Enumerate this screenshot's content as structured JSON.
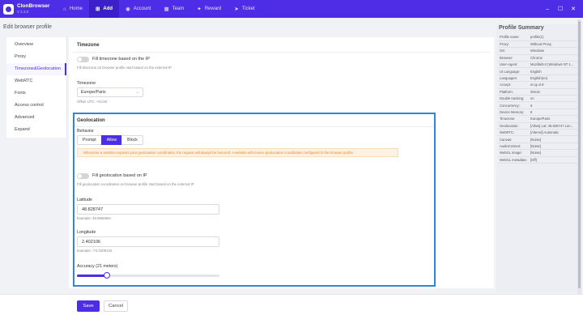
{
  "app": {
    "name": "ClonBrowser",
    "version": "V 2.3.0"
  },
  "nav": {
    "items": [
      {
        "label": "Home",
        "icon": "home-icon"
      },
      {
        "label": "Add",
        "icon": "add-icon"
      },
      {
        "label": "Account",
        "icon": "account-icon"
      },
      {
        "label": "Team",
        "icon": "team-icon"
      },
      {
        "label": "Reward",
        "icon": "reward-icon"
      },
      {
        "label": "Ticket",
        "icon": "ticket-icon"
      }
    ],
    "active": "Add",
    "accent_color": "#4d2ee6"
  },
  "window": {
    "minimize": "–",
    "restore": "☐",
    "close": "✕"
  },
  "page_title": "Edit browser profile",
  "sidebar": {
    "items": [
      {
        "label": "Overview"
      },
      {
        "label": "Proxy"
      },
      {
        "label": "Timezone&Geolocation"
      },
      {
        "label": "WebRTC"
      },
      {
        "label": "Fonts"
      },
      {
        "label": "Access control"
      },
      {
        "label": "Advanced"
      },
      {
        "label": "Expand"
      }
    ],
    "active": "Timezone&Geolocation"
  },
  "timezone": {
    "title": "Timezone",
    "toggle_label": "Fill timezone based on the IP",
    "toggle_on": false,
    "toggle_hint": "Fill timezone on browser profile start based on the external IP",
    "field_label": "Timezone",
    "value": "Europe/Paris",
    "offset": "Offset UTC: +01:00"
  },
  "geolocation": {
    "title": "Geolocation",
    "behavior_label": "Behavior",
    "behavior_options": [
      "Prompt",
      "Allow",
      "Block"
    ],
    "behavior_selected": "Allow",
    "warning": "Whenever a website requests your geolocation coordinates, the request will always be honored. A website will receive geolocation coordinates configured in the browser profile.",
    "toggle_label": "Fill geolocation based on IP",
    "toggle_on": false,
    "toggle_hint": "Fill geolocation coordinates on browser profile start based on the external IP",
    "latitude_label": "Latitude",
    "latitude_value": "48.828747",
    "latitude_example": "Example: 48.8656954",
    "longitude_label": "Longitude",
    "longitude_value": "2.402106",
    "longitude_example": "Example: -74.0209120",
    "accuracy_label": "Accuracy (21 meters)",
    "accuracy_fraction": 0.21
  },
  "summary": {
    "title": "Profile Summary",
    "rows": [
      {
        "key": "Profile name:",
        "value": "profile(1)"
      },
      {
        "key": "Proxy:",
        "value": "Without Proxy"
      },
      {
        "key": "OS:",
        "value": "Windows"
      },
      {
        "key": "Browser:",
        "value": "Chrome"
      },
      {
        "key": "User-Agent:",
        "value": "Mozilla/5.0 (Windows NT 1..."
      },
      {
        "key": "UI Language:",
        "value": "English"
      },
      {
        "key": "Languages:",
        "value": "English(en)"
      },
      {
        "key": "Accept:",
        "value": "en;q=0.9"
      },
      {
        "key": "Platform:",
        "value": "Win32"
      },
      {
        "key": "Double tracking:",
        "value": "on"
      },
      {
        "key": "Concurrency:",
        "value": "6"
      },
      {
        "key": "Device Memory:",
        "value": "8"
      },
      {
        "key": "Timezone:",
        "value": "Europe/Paris"
      },
      {
        "key": "Geolocation:",
        "value": "[Allow] Lat: 48.828747 Lon..."
      },
      {
        "key": "WebRTC:",
        "value": "[Altered] Automatic"
      },
      {
        "key": "Canvas:",
        "value": "[Noise]"
      },
      {
        "key": "AudioContext:",
        "value": "[Noise]"
      },
      {
        "key": "WebGL image:",
        "value": "[Noise]"
      },
      {
        "key": "WebGL metadata:",
        "value": "[Off]"
      }
    ]
  },
  "footer": {
    "save_label": "Save",
    "cancel_label": "Cancel"
  }
}
